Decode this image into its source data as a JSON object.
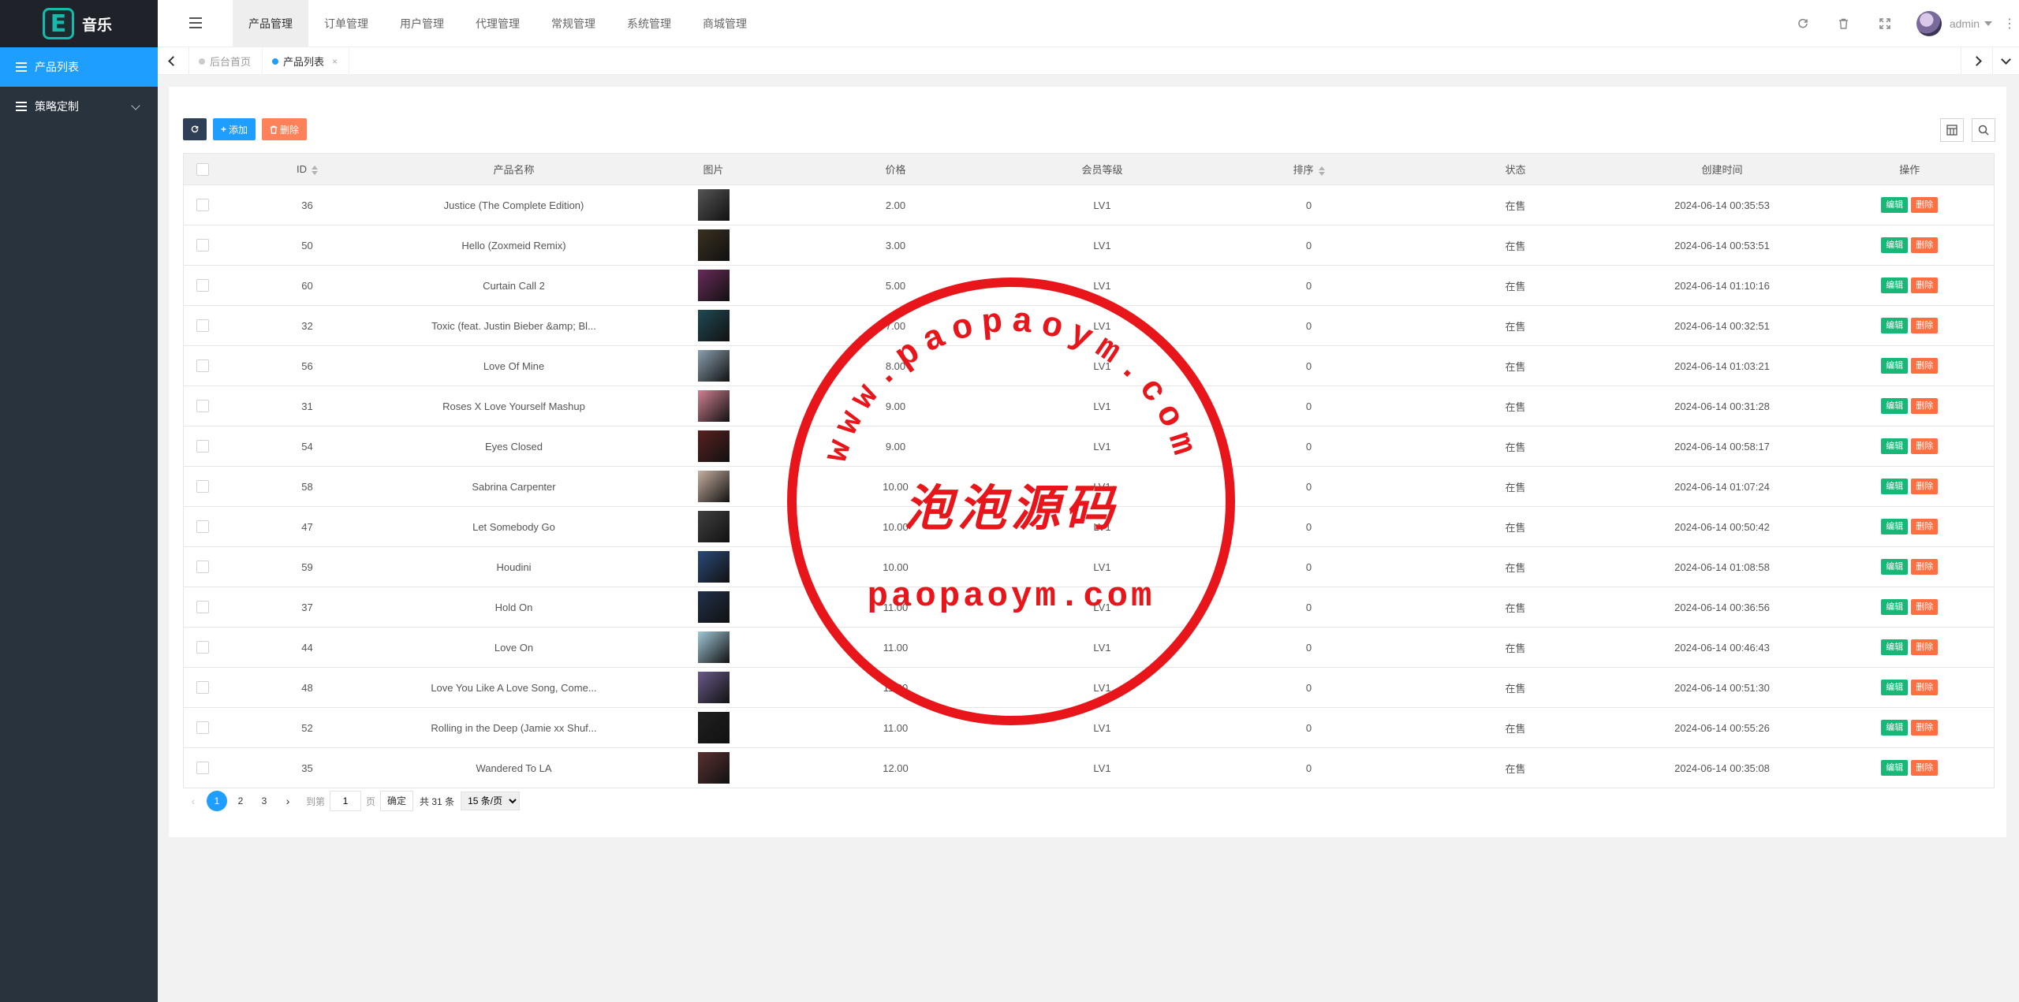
{
  "brand": {
    "logo_letter": "E",
    "name": "音乐"
  },
  "sidebar": {
    "items": [
      {
        "label": "产品列表",
        "active": true
      },
      {
        "label": "策略定制",
        "active": false
      }
    ]
  },
  "topnav": {
    "items": [
      "产品管理",
      "订单管理",
      "用户管理",
      "代理管理",
      "常规管理",
      "系统管理",
      "商城管理"
    ],
    "active_index": 0
  },
  "user": {
    "name": "admin"
  },
  "tabs": [
    {
      "label": "后台首页",
      "active": false
    },
    {
      "label": "产品列表",
      "active": true,
      "close": "×"
    }
  ],
  "toolbar": {
    "add_label": "添加",
    "delete_label": "删除"
  },
  "table": {
    "columns": [
      "ID",
      "产品名称",
      "图片",
      "价格",
      "会员等级",
      "排序",
      "状态",
      "创建时间",
      "操作"
    ],
    "edit_label": "编辑",
    "delete_label": "删除",
    "rows": [
      {
        "id": "36",
        "name": "Justice (The Complete Edition)",
        "price": "2.00",
        "level": "LV1",
        "sort": "0",
        "status": "在售",
        "created": "2024-06-14 00:35:53",
        "thumb_color": "#555"
      },
      {
        "id": "50",
        "name": "Hello (Zoxmeid Remix)",
        "price": "3.00",
        "level": "LV1",
        "sort": "0",
        "status": "在售",
        "created": "2024-06-14 00:53:51",
        "thumb_color": "#3a3020"
      },
      {
        "id": "60",
        "name": "Curtain Call 2",
        "price": "5.00",
        "level": "LV1",
        "sort": "0",
        "status": "在售",
        "created": "2024-06-14 01:10:16",
        "thumb_color": "#6a2a5a"
      },
      {
        "id": "32",
        "name": "Toxic (feat. Justin Bieber &amp; Bl...",
        "price": "7.00",
        "level": "LV1",
        "sort": "0",
        "status": "在售",
        "created": "2024-06-14 00:32:51",
        "thumb_color": "#1f4a55"
      },
      {
        "id": "56",
        "name": "Love Of Mine",
        "price": "8.00",
        "level": "LV1",
        "sort": "0",
        "status": "在售",
        "created": "2024-06-14 01:03:21",
        "thumb_color": "#8aa0b0"
      },
      {
        "id": "31",
        "name": "Roses X Love Yourself Mashup",
        "price": "9.00",
        "level": "LV1",
        "sort": "0",
        "status": "在售",
        "created": "2024-06-14 00:31:28",
        "thumb_color": "#d08090"
      },
      {
        "id": "54",
        "name": "Eyes Closed",
        "price": "9.00",
        "level": "LV1",
        "sort": "0",
        "status": "在售",
        "created": "2024-06-14 00:58:17",
        "thumb_color": "#5a2020"
      },
      {
        "id": "58",
        "name": "Sabrina Carpenter",
        "price": "10.00",
        "level": "LV1",
        "sort": "0",
        "status": "在售",
        "created": "2024-06-14 01:07:24",
        "thumb_color": "#c8b0a0"
      },
      {
        "id": "47",
        "name": "Let Somebody Go",
        "price": "10.00",
        "level": "LV1",
        "sort": "0",
        "status": "在售",
        "created": "2024-06-14 00:50:42",
        "thumb_color": "#404040"
      },
      {
        "id": "59",
        "name": "Houdini",
        "price": "10.00",
        "level": "LV1",
        "sort": "0",
        "status": "在售",
        "created": "2024-06-14 01:08:58",
        "thumb_color": "#2a4a7a"
      },
      {
        "id": "37",
        "name": "Hold On",
        "price": "11.00",
        "level": "LV1",
        "sort": "0",
        "status": "在售",
        "created": "2024-06-14 00:36:56",
        "thumb_color": "#20304a"
      },
      {
        "id": "44",
        "name": "Love On",
        "price": "11.00",
        "level": "LV1",
        "sort": "0",
        "status": "在售",
        "created": "2024-06-14 00:46:43",
        "thumb_color": "#a0c8d8"
      },
      {
        "id": "48",
        "name": "Love You Like A Love Song, Come...",
        "price": "11.00",
        "level": "LV1",
        "sort": "0",
        "status": "在售",
        "created": "2024-06-14 00:51:30",
        "thumb_color": "#6a5a8a"
      },
      {
        "id": "52",
        "name": "Rolling in the Deep (Jamie xx Shuf...",
        "price": "11.00",
        "level": "LV1",
        "sort": "0",
        "status": "在售",
        "created": "2024-06-14 00:55:26",
        "thumb_color": "#202020"
      },
      {
        "id": "35",
        "name": "Wandered To LA",
        "price": "12.00",
        "level": "LV1",
        "sort": "0",
        "status": "在售",
        "created": "2024-06-14 00:35:08",
        "thumb_color": "#5a3030"
      }
    ]
  },
  "pager": {
    "pages": [
      "1",
      "2",
      "3"
    ],
    "current": "1",
    "goto_label": "到第",
    "page_value": "1",
    "page_unit": "页",
    "confirm_label": "确定",
    "total_label": "共 31 条",
    "page_size": "15 条/页"
  },
  "watermark": {
    "arc_text": "www.paopaoym.com",
    "center_text": "泡泡源码",
    "bottom_text": "paopaoym.com",
    "color": "#e8161b"
  }
}
